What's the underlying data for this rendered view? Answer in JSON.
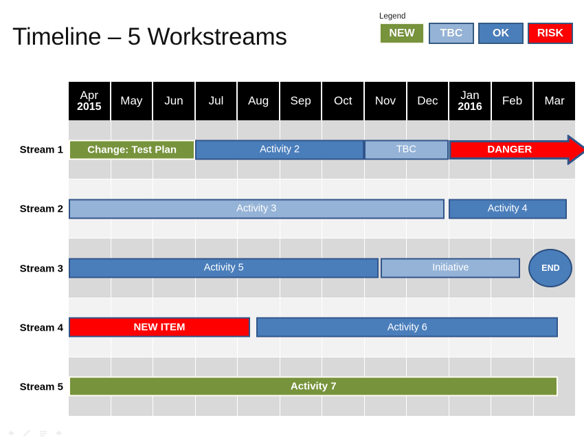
{
  "slide": {
    "title": "Timeline – 5 Workstreams"
  },
  "legend": {
    "title": "Legend",
    "items": [
      {
        "label": "NEW",
        "color": "#77933c",
        "border": "#fffdf2"
      },
      {
        "label": "TBC",
        "color": "#95b3d7",
        "border": "#34597f"
      },
      {
        "label": "OK",
        "color": "#4a7ebb",
        "border": "#34597f"
      },
      {
        "label": "RISK",
        "color": "#ff0000",
        "border": "#34597f"
      }
    ]
  },
  "chart_data": {
    "type": "bar",
    "title": "Timeline – 5 Workstreams",
    "xlabel": "",
    "ylabel": "",
    "grid": true,
    "legend_position": "top-right",
    "categories": [
      "Apr",
      "May",
      "Jun",
      "Jul",
      "Aug",
      "Sep",
      "Oct",
      "Nov",
      "Dec",
      "Jan",
      "Feb",
      "Mar"
    ],
    "column_years": [
      "2015",
      "",
      "",
      "",
      "",
      "",
      "",
      "",
      "",
      "2016",
      "",
      ""
    ],
    "rows": [
      {
        "name": "Stream 1",
        "band": "dark",
        "bars": [
          {
            "label": "Change: Test Plan",
            "start": 0,
            "end": 3,
            "style": "green",
            "shape": "rect"
          },
          {
            "label": "Activity 2",
            "start": 3,
            "end": 7,
            "style": "blue-dark",
            "shape": "rect"
          },
          {
            "label": "TBC",
            "start": 7,
            "end": 9,
            "style": "blue-light",
            "shape": "rect"
          },
          {
            "label": "DANGER",
            "start": 9,
            "end": 12,
            "style": "red",
            "shape": "arrow"
          }
        ]
      },
      {
        "name": "Stream 2",
        "band": "light",
        "bars": [
          {
            "label": "Activity 3",
            "start": 0,
            "end": 8.9,
            "style": "blue-light",
            "shape": "rect"
          },
          {
            "label": "Activity 4",
            "start": 9,
            "end": 11.8,
            "style": "blue-dark",
            "shape": "rect"
          }
        ]
      },
      {
        "name": "Stream 3",
        "band": "dark",
        "bars": [
          {
            "label": "Activity 5",
            "start": 0,
            "end": 7.35,
            "style": "blue-dark",
            "shape": "rect"
          },
          {
            "label": "Initiative",
            "start": 7.4,
            "end": 10.7,
            "style": "blue-light",
            "shape": "rect"
          },
          {
            "label": "END",
            "start": 10.9,
            "end": 11.9,
            "style": "blue-dark",
            "shape": "ellipse"
          }
        ]
      },
      {
        "name": "Stream 4",
        "band": "light",
        "bars": [
          {
            "label": "NEW ITEM",
            "start": 0,
            "end": 4.3,
            "style": "red",
            "shape": "rect"
          },
          {
            "label": "Activity 6",
            "start": 4.45,
            "end": 11.6,
            "style": "blue-dark",
            "shape": "rect"
          }
        ]
      },
      {
        "name": "Stream 5",
        "band": "dark",
        "bars": [
          {
            "label": "Activity 7",
            "start": 0,
            "end": 11.6,
            "style": "green",
            "shape": "rect"
          }
        ]
      }
    ]
  },
  "bottom_toolbar": {
    "icons": [
      "back-arrow-icon",
      "pencil-icon",
      "lines-icon",
      "forward-arrow-icon"
    ]
  }
}
